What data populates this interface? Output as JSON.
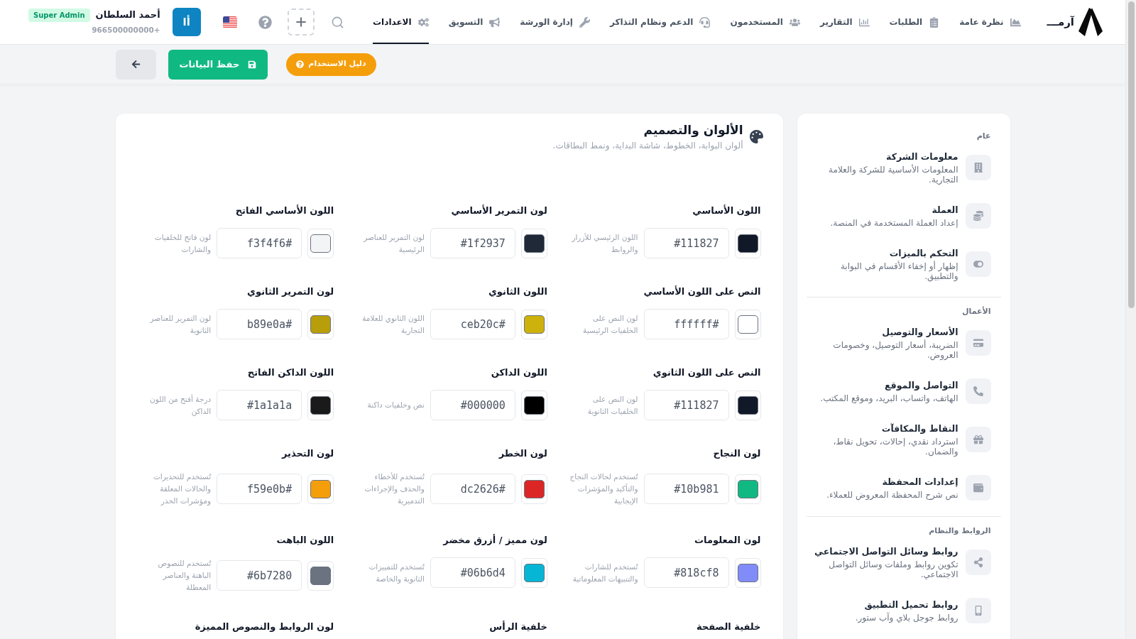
{
  "header": {
    "brand_name": "آرمـــ",
    "nav": [
      {
        "label": "نظرة عامة",
        "selected": false
      },
      {
        "label": "الطلبات",
        "selected": false
      },
      {
        "label": "التقارير",
        "selected": false
      },
      {
        "label": "المستخدمون",
        "selected": false
      },
      {
        "label": "الدعم ونظام التذاكر",
        "selected": false
      },
      {
        "label": "إدارة الورشة",
        "selected": false
      },
      {
        "label": "التسويق",
        "selected": false
      },
      {
        "label": "الاعدادات",
        "selected": true
      }
    ],
    "user": {
      "avatar_initials": "أا",
      "name": "أحمد السلطان",
      "role_badge": "Super Admin",
      "phone": "+966500000000"
    }
  },
  "toolbar": {
    "guide_button": "دليل الاستخدام",
    "save_button": "حفظ البيانات"
  },
  "panel": {
    "title": "الألوان والتصميم",
    "subtitle": "ألوان البوابة، الخطوط، شاشة البداية، ونمط البطاقات.",
    "fields": [
      {
        "label": "اللون الأساسي",
        "color": "#111827",
        "value": "#111827",
        "description": "اللون الرئيسي للأزرار والروابط"
      },
      {
        "label": "لون التمرير الأساسي",
        "color": "#1f2937",
        "value": "#1f2937",
        "description": "لون التمرير للعناصر الرئيسية"
      },
      {
        "label": "اللون الأساسي الفاتح",
        "color": "#f3f4f6",
        "value": "#f3f4f6",
        "description": "لون فاتح للخلفيات والشارات"
      },
      {
        "label": "النص على اللون الأساسي",
        "color": "#ffffff",
        "value": "#ffffff",
        "description": "لون النص على الخلفيات الرئيسية"
      },
      {
        "label": "اللون الثانوي",
        "color": "#ceb20c",
        "value": "#ceb20c",
        "description": "اللون الثانوي للعلامة التجارية"
      },
      {
        "label": "لون التمرير الثانوي",
        "color": "#b89e0a",
        "value": "#b89e0a",
        "description": "لون التمرير للعناصر الثانوية"
      },
      {
        "label": "النص على اللون الثانوي",
        "color": "#111827",
        "value": "#111827",
        "description": "لون النص على الخلفيات الثانوية"
      },
      {
        "label": "اللون الداكن",
        "color": "#000000",
        "value": "#000000",
        "description": "نص وخلفيات داكنة"
      },
      {
        "label": "اللون الداكن الفاتح",
        "color": "#1a1a1a",
        "value": "#1a1a1a",
        "description": "درجة أفتح من اللون الداكن"
      },
      {
        "label": "لون النجاح",
        "color": "#10b981",
        "value": "#10b981",
        "description": "تُستخدم لحالات النجاح والتأكيد والمؤشرات الإيجابية"
      },
      {
        "label": "لون الخطر",
        "color": "#dc2626",
        "value": "#dc2626",
        "description": "تُستخدم للأخطاء والحذف والإجراءات التدميرية"
      },
      {
        "label": "لون التحذير",
        "color": "#f59e0b",
        "value": "#f59e0b",
        "description": "تُستخدم للتحذيرات والحالات المعلقة ومؤشرات الحذر"
      },
      {
        "label": "لون المعلومات",
        "color": "#818cf8",
        "value": "#818cf8",
        "description": "تُستخدم للشارات والتنبيهات المعلوماتية"
      },
      {
        "label": "لون مميز / أزرق مخضر",
        "color": "#06b6d4",
        "value": "#06b6d4",
        "description": "تُستخدم للتمييزات الثانوية والخاصة"
      },
      {
        "label": "اللون الباهت",
        "color": "#6b7280",
        "value": "#6b7280",
        "description": "تُستخدم للنصوص الباهتة والعناصر المعطلة"
      },
      {
        "label": "خلفية الصفحة"
      },
      {
        "label": "خلفية الرأس"
      },
      {
        "label": "لون الروابط والنصوص المميزة"
      }
    ]
  },
  "sidebar": {
    "sections": [
      {
        "heading": "عام",
        "items": [
          {
            "title": "معلومات الشركة",
            "description": "المعلومات الأساسية للشركة والعلامة التجارية.",
            "selected": false
          },
          {
            "title": "العملة",
            "description": "إعداد العملة المستخدمة في المنصة.",
            "selected": false
          },
          {
            "title": "التحكم بالميزات",
            "description": "إظهار أو إخفاء الأقسام في البوابة والتطبيق.",
            "selected": false
          }
        ]
      },
      {
        "heading": "الأعمال",
        "items": [
          {
            "title": "الأسعار والتوصيل",
            "description": "الضريبة، أسعار التوصيل، وخصومات العروض.",
            "selected": false
          },
          {
            "title": "التواصل والموقع",
            "description": "الهاتف، واتساب، البريد، وموقع المكتب.",
            "selected": false
          },
          {
            "title": "النقاط والمكافآت",
            "description": "استرداد نقدي، إحالات، تحويل نقاط، والضمان.",
            "selected": false
          },
          {
            "title": "إعدادات المحفظة",
            "description": "نص شرح المحفظة المعروض للعملاء.",
            "selected": false
          }
        ]
      },
      {
        "heading": "الروابط والنظام",
        "items": [
          {
            "title": "روابط وسائل التواصل الاجتماعي",
            "description": "تكوين روابط وملفات وسائل التواصل الاجتماعي.",
            "selected": false
          },
          {
            "title": "روابط تحميل التطبيق",
            "description": "روابط جوجل بلاي وآب ستور.",
            "selected": false
          }
        ]
      }
    ]
  }
}
